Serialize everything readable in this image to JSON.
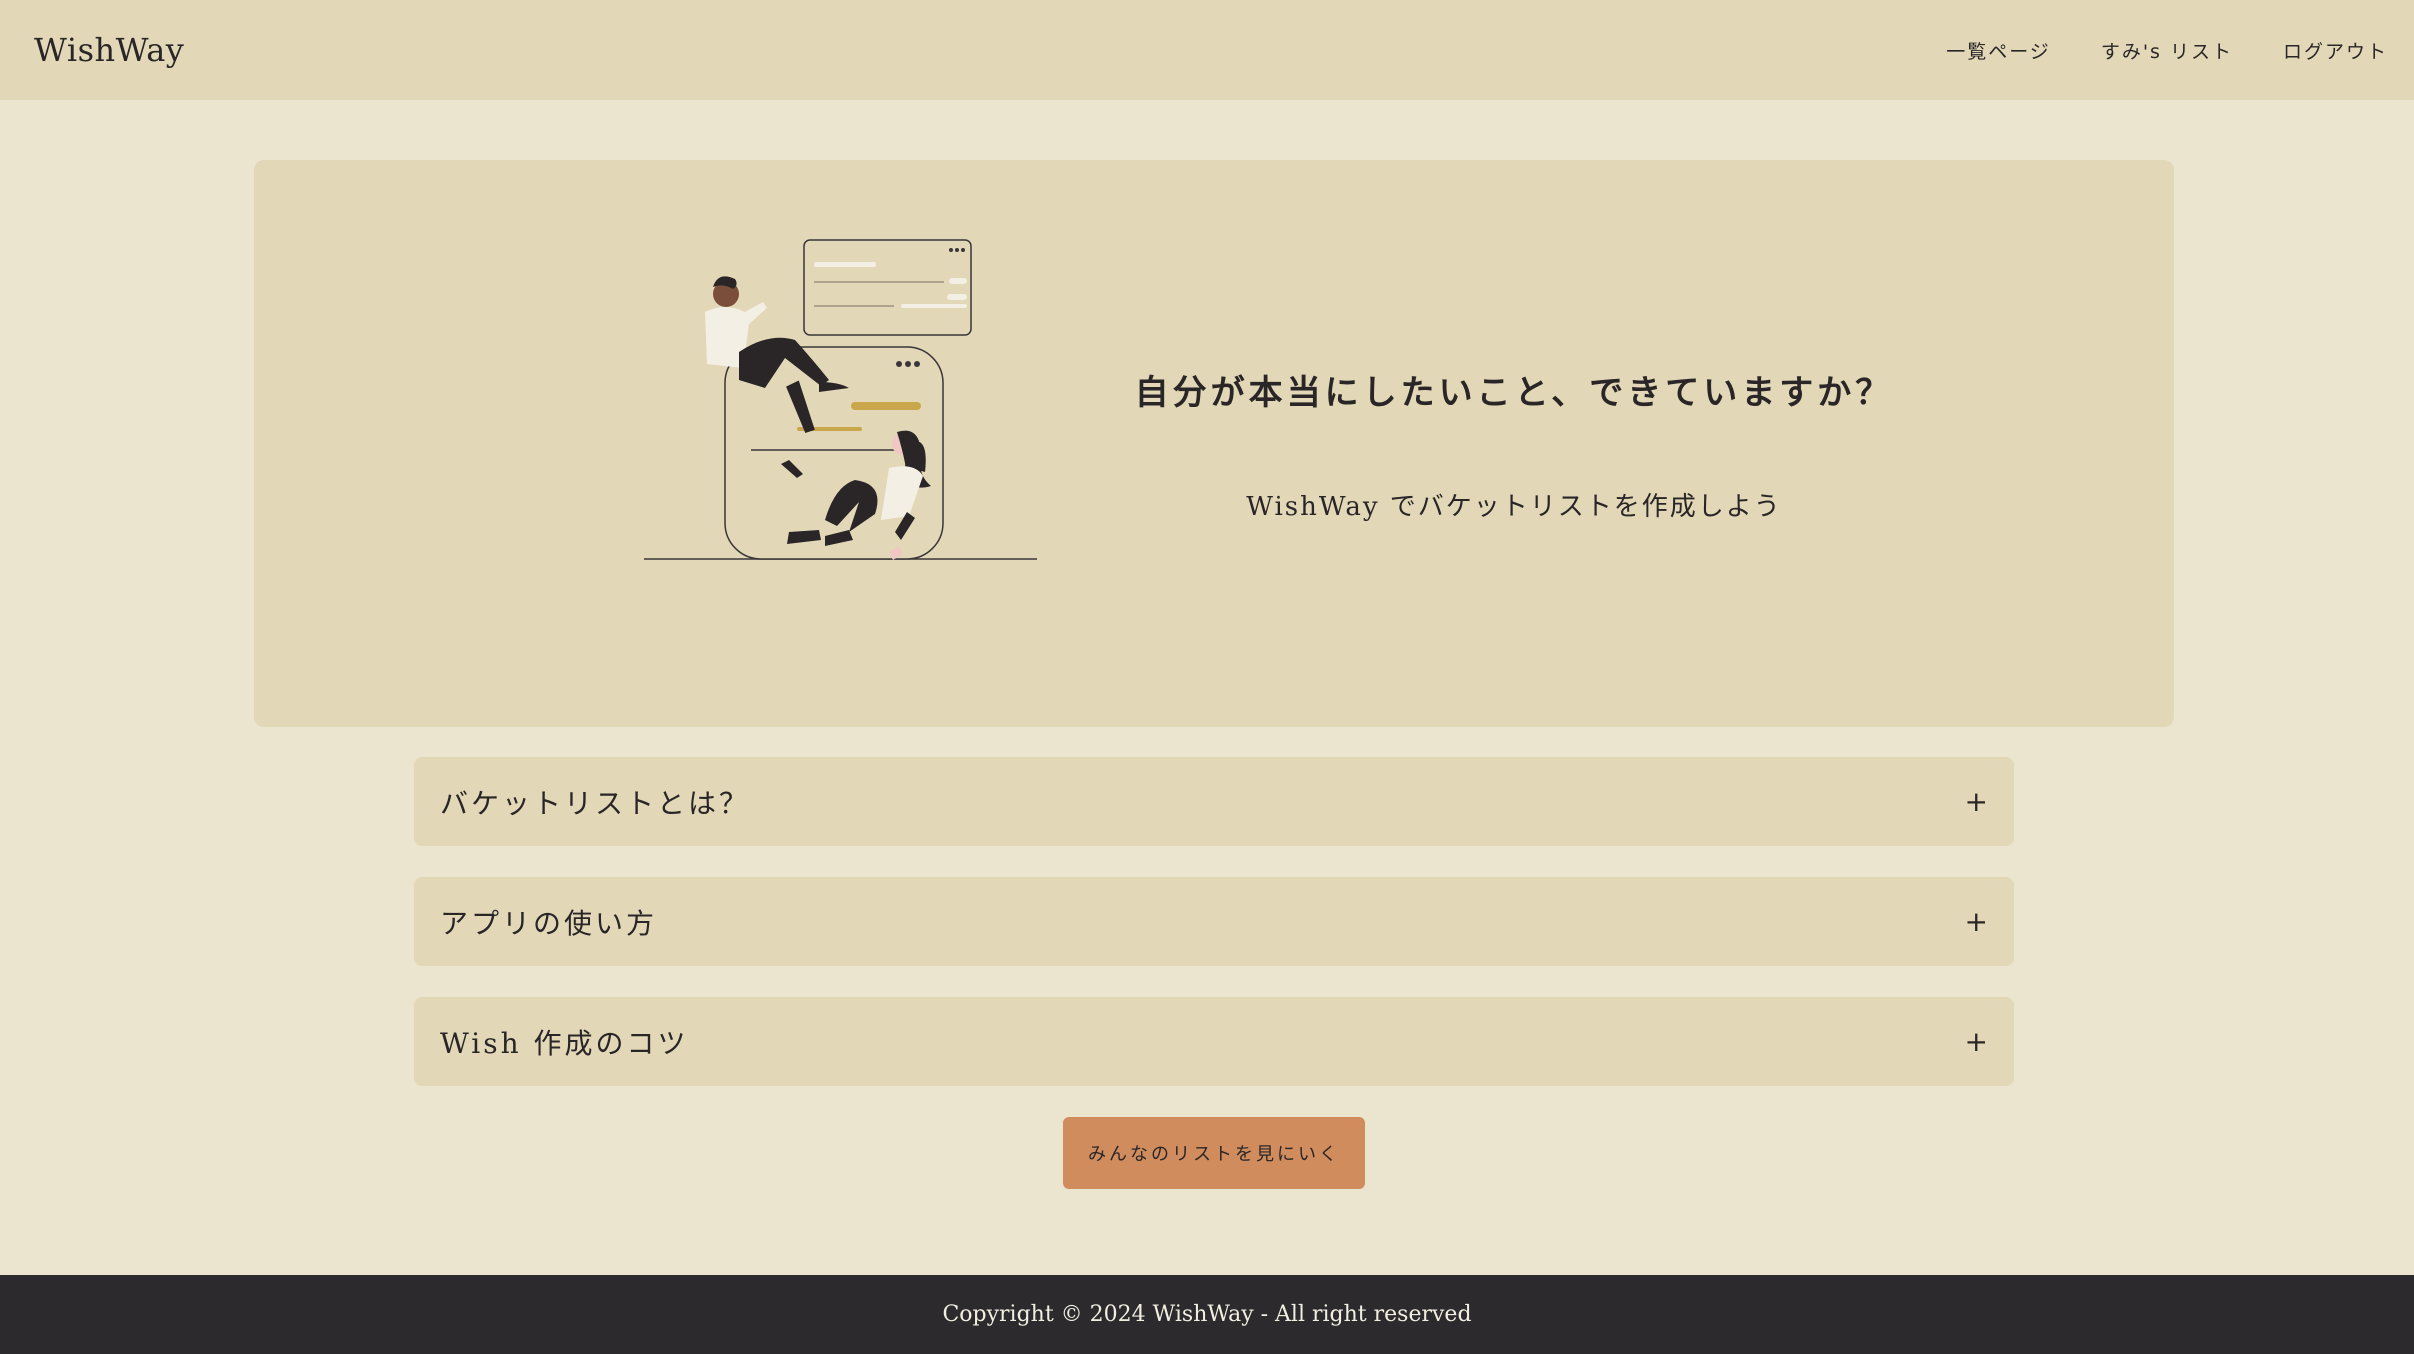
{
  "header": {
    "logo": "WishWay",
    "nav": [
      {
        "label": "一覧ページ"
      },
      {
        "label": "すみ's リスト"
      },
      {
        "label": "ログアウト"
      }
    ]
  },
  "hero": {
    "headline": "自分が本当にしたいこと、できていますか？",
    "subtitle": "WishWay でバケットリストを作成しよう"
  },
  "accordion": [
    {
      "label": "バケットリストとは？",
      "icon": "plus-icon"
    },
    {
      "label": "アプリの使い方",
      "icon": "plus-icon"
    },
    {
      "label": "Wish 作成のコツ",
      "icon": "plus-icon"
    }
  ],
  "cta": {
    "label": "みんなのリストを見にいく"
  },
  "footer": {
    "copyright": "Copyright © 2024 WishWay - All right reserved"
  },
  "colors": {
    "background": "#ebe4cf",
    "panel": "#e2d8b7",
    "accent": "#d08c5c",
    "footer": "#2c2a2c",
    "text": "#2a2628"
  }
}
